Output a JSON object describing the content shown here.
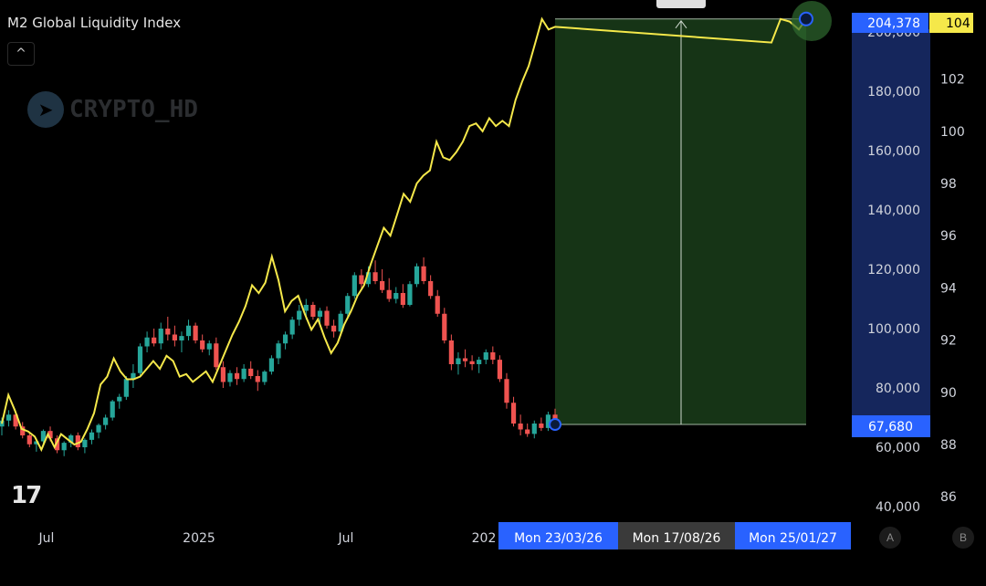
{
  "header": {
    "title": "M2 Global Liquidity Index",
    "collapse_icon": "chevron-up-icon"
  },
  "watermark": {
    "text": "CRYPTO_HD",
    "icon": "telegram-icon"
  },
  "logo": {
    "text": "17"
  },
  "axis_buttons": {
    "left": "A",
    "right": "B"
  },
  "colors": {
    "background": "#000000",
    "candle_up": "#26a69a",
    "candle_down": "#ef5350",
    "liquidity_line": "#f5e84a",
    "projection_fill": "#1a3d1a",
    "price_label": "#2962ff",
    "liquidity_label": "#f5e84a"
  },
  "chart_data": {
    "type": "line",
    "x_ticks": [
      "Jul",
      "2025",
      "Jul",
      "202"
    ],
    "y_left_ticks": [
      40000,
      60000,
      80000,
      100000,
      120000,
      140000,
      160000,
      180000,
      200000
    ],
    "y_left_range": [
      34000,
      212000
    ],
    "y_right_ticks": [
      86,
      88,
      90,
      92,
      94,
      96,
      98,
      100,
      102,
      104
    ],
    "y_right_range": [
      85.4,
      104.6
    ],
    "price_last_label": "67,680",
    "price_target_label": "204,378",
    "liquidity_last_label": "104",
    "date_labels": [
      "Mon 23/03/26",
      "Mon 17/08/26",
      "Mon 25/01/27"
    ],
    "projection": {
      "start_date": "Mon 23/03/26",
      "end_date": "Mon 25/01/27",
      "from": 67680,
      "to": 204378
    },
    "series": [
      {
        "type": "candlestick",
        "values": [
          [
            67000,
            70000,
            64000,
            69000
          ],
          [
            69000,
            72500,
            67000,
            71000
          ],
          [
            71000,
            72000,
            66000,
            67000
          ],
          [
            67000,
            68500,
            63000,
            64000
          ],
          [
            64000,
            65000,
            60000,
            61000
          ],
          [
            61000,
            63000,
            58500,
            62000
          ],
          [
            62000,
            66000,
            61000,
            65500
          ],
          [
            65500,
            67000,
            62000,
            63000
          ],
          [
            63000,
            64000,
            58000,
            59000
          ],
          [
            59000,
            62000,
            57000,
            61500
          ],
          [
            61500,
            64500,
            60000,
            64000
          ],
          [
            64000,
            65000,
            59000,
            60000
          ],
          [
            60000,
            63000,
            58000,
            62500
          ],
          [
            62500,
            66000,
            61000,
            65000
          ],
          [
            65000,
            68000,
            63000,
            67500
          ],
          [
            67500,
            71000,
            66000,
            70000
          ],
          [
            70000,
            76000,
            69000,
            75500
          ],
          [
            75500,
            78000,
            73000,
            77000
          ],
          [
            77000,
            84000,
            76000,
            83000
          ],
          [
            83000,
            88000,
            80000,
            85000
          ],
          [
            85000,
            95000,
            84000,
            94000
          ],
          [
            94000,
            99000,
            92000,
            97000
          ],
          [
            97000,
            100000,
            94000,
            95000
          ],
          [
            95000,
            102000,
            93000,
            100000
          ],
          [
            100000,
            104000,
            96000,
            98000
          ],
          [
            98000,
            101000,
            94000,
            96000
          ],
          [
            96000,
            99000,
            92000,
            97500
          ],
          [
            97500,
            103000,
            96000,
            101000
          ],
          [
            101000,
            102000,
            95000,
            96000
          ],
          [
            96000,
            98000,
            92000,
            93000
          ],
          [
            93000,
            96000,
            91000,
            95000
          ],
          [
            95000,
            97000,
            86000,
            87000
          ],
          [
            87000,
            89000,
            80000,
            82000
          ],
          [
            82000,
            86000,
            80500,
            85000
          ],
          [
            85000,
            87000,
            81000,
            83000
          ],
          [
            83000,
            88000,
            82000,
            86500
          ],
          [
            86500,
            89000,
            83000,
            84000
          ],
          [
            84000,
            86000,
            79000,
            82000
          ],
          [
            82000,
            86000,
            81000,
            85500
          ],
          [
            85500,
            91000,
            84500,
            90000
          ],
          [
            90000,
            96000,
            88000,
            95000
          ],
          [
            95000,
            99000,
            93000,
            98000
          ],
          [
            98000,
            104000,
            96500,
            103000
          ],
          [
            103000,
            108000,
            101000,
            106000
          ],
          [
            106000,
            110000,
            103000,
            108000
          ],
          [
            108000,
            109000,
            103000,
            104000
          ],
          [
            104000,
            107000,
            101000,
            106000
          ],
          [
            106000,
            107500,
            100000,
            101000
          ],
          [
            101000,
            103000,
            97000,
            99000
          ],
          [
            99000,
            106000,
            98000,
            105000
          ],
          [
            105000,
            112000,
            104000,
            111000
          ],
          [
            111000,
            119000,
            110000,
            118000
          ],
          [
            118000,
            120000,
            113000,
            115000
          ],
          [
            115000,
            121000,
            114000,
            119000
          ],
          [
            119000,
            123000,
            115000,
            116000
          ],
          [
            116000,
            120000,
            112000,
            113000
          ],
          [
            113000,
            117000,
            109000,
            110000
          ],
          [
            110000,
            114000,
            108500,
            112000
          ],
          [
            112000,
            115000,
            107000,
            108000
          ],
          [
            108000,
            116000,
            107500,
            115000
          ],
          [
            115000,
            122000,
            114000,
            121000
          ],
          [
            121000,
            124000,
            115000,
            116000
          ],
          [
            116000,
            118000,
            110000,
            111000
          ],
          [
            111000,
            113000,
            104000,
            105000
          ],
          [
            105000,
            107000,
            95000,
            96000
          ],
          [
            96000,
            98000,
            86000,
            88000
          ],
          [
            88000,
            92000,
            84500,
            90000
          ],
          [
            90000,
            93000,
            87000,
            89000
          ],
          [
            89000,
            91000,
            86000,
            88000
          ],
          [
            88000,
            90500,
            85000,
            89500
          ],
          [
            89500,
            93000,
            88000,
            92000
          ],
          [
            92000,
            94000,
            88000,
            89500
          ],
          [
            89500,
            91000,
            82000,
            83000
          ],
          [
            83000,
            85000,
            73000,
            75000
          ],
          [
            75000,
            77000,
            67000,
            68000
          ],
          [
            68000,
            71000,
            64000,
            66000
          ],
          [
            66000,
            68000,
            63500,
            64500
          ],
          [
            64500,
            69000,
            63000,
            68000
          ],
          [
            68000,
            70000,
            65500,
            66500
          ],
          [
            66500,
            72000,
            65500,
            71000
          ],
          [
            71000,
            73000,
            66000,
            67680
          ]
        ]
      },
      {
        "name": "M2 Global Liquidity Index",
        "axis": "right",
        "values": [
          88.8,
          89.9,
          89.3,
          88.6,
          88.5,
          88.3,
          87.8,
          88.4,
          87.9,
          88.4,
          88.2,
          88.0,
          88.1,
          88.6,
          89.2,
          90.3,
          90.6,
          91.3,
          90.8,
          90.5,
          90.5,
          90.6,
          90.9,
          91.2,
          90.9,
          91.4,
          91.2,
          90.6,
          90.7,
          90.4,
          90.6,
          90.8,
          90.4,
          91.0,
          91.6,
          92.2,
          92.7,
          93.3,
          94.1,
          93.8,
          94.2,
          95.2,
          94.3,
          93.1,
          93.5,
          93.7,
          93.0,
          92.4,
          92.8,
          92.1,
          91.5,
          91.9,
          92.6,
          93.1,
          93.7,
          94.1,
          94.9,
          95.6,
          96.3,
          96.0,
          96.8,
          97.6,
          97.3,
          98.0,
          98.3,
          98.5,
          99.6,
          99.0,
          98.9,
          99.2,
          99.6,
          100.2,
          100.3,
          100.0,
          100.5,
          100.2,
          100.4,
          100.2,
          101.2,
          101.9,
          102.5,
          103.4,
          104.3,
          103.9,
          104.0
        ]
      }
    ]
  }
}
